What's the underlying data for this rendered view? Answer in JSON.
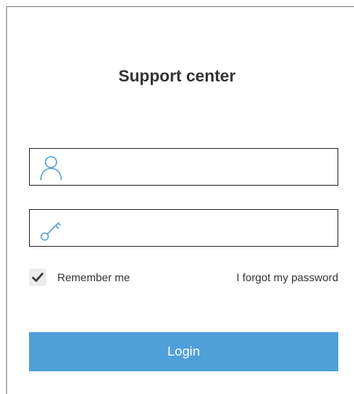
{
  "title": "Support center",
  "username": {
    "icon": "user-icon",
    "value": "",
    "placeholder": ""
  },
  "password": {
    "icon": "key-icon",
    "value": "",
    "placeholder": ""
  },
  "remember": {
    "label": "Remember me",
    "checked": true,
    "icon": "checkmark-icon"
  },
  "forgot_password": "I forgot my password",
  "login_button": "Login",
  "colors": {
    "accent": "#4f9fd8",
    "icon": "#5aa2d9",
    "text": "#333333",
    "checkbox_bg": "#ececec",
    "checkmark": "#3b3b3b"
  }
}
